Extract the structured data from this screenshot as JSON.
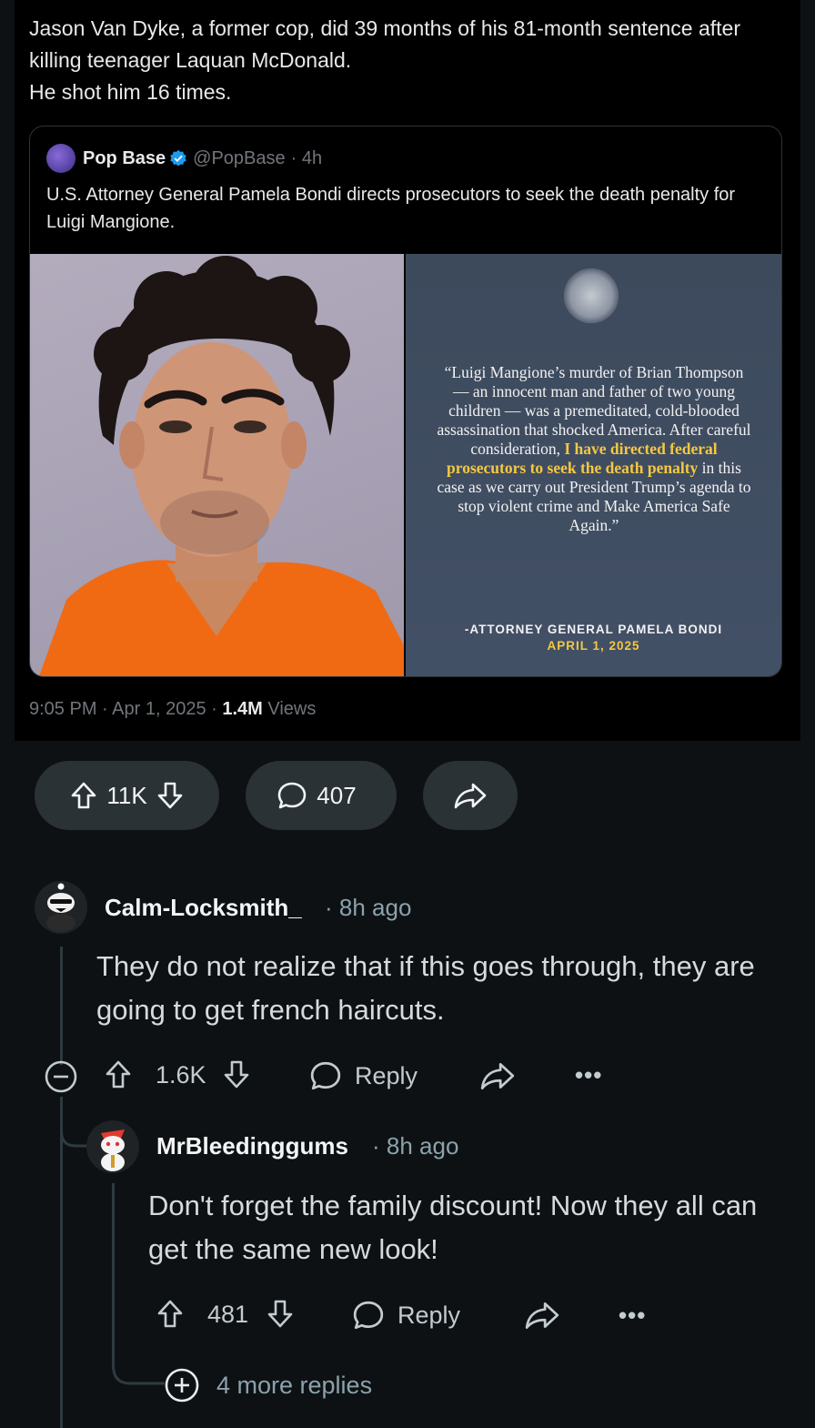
{
  "tweet": {
    "text": "Jason Van Dyke, a former cop, did 39 months of his 81-month sentence after killing teenager Laquan McDonald.\nHe shot him 16 times.",
    "quoted": {
      "author": "Pop Base",
      "handle": "@PopBase",
      "age": "· 4h",
      "text": "U.S. Attorney General Pamela Bondi directs prosecutors to seek the death penalty for Luigi Mangione.",
      "image_quote_pre": "“Luigi Mangione’s murder of Brian Thompson — an innocent man and father of two young children — was a premeditated, cold-blooded assassination that shocked America. After careful consideration, ",
      "image_quote_highlight": "I have directed federal prosecutors to seek the death penalty",
      "image_quote_post": " in this case as we carry out President Trump’s agenda to stop violent crime and Make America Safe Again.”",
      "image_signature": "-ATTORNEY GENERAL PAMELA BONDI",
      "image_date": "APRIL 1, 2025"
    },
    "meta_time": "9:05 PM · Apr 1, 2025 · ",
    "meta_views_count": "1.4M",
    "meta_views_label": " Views"
  },
  "post_actions": {
    "score": "11K",
    "comments": "407"
  },
  "comments": [
    {
      "username": "Calm-Locksmith_",
      "age": "8h ago",
      "body": "They do not realize that if this goes through, they are going to get french haircuts.",
      "score": "1.6K",
      "reply_label": "Reply"
    },
    {
      "username": "MrBleedinggums",
      "age": "8h ago",
      "body": "Don't forget the family discount! Now they all can get the same new look!",
      "score": "481",
      "reply_label": "Reply"
    }
  ],
  "more_replies": "4 more replies",
  "colors": {
    "background": "#0e1113",
    "pill": "#2a3236",
    "highlight": "#f5c842",
    "verified": "#1d9bf0"
  }
}
